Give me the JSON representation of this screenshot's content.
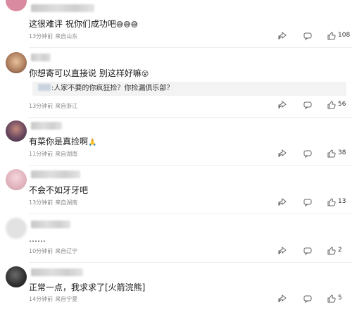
{
  "comments": [
    {
      "text": "这很难评 祝你们成功吧",
      "emoji": "😅😅😅",
      "time": "13分钟前",
      "location": "来自山东",
      "likes": "108",
      "icons": [
        "share-icon",
        "reply-icon",
        "like-icon"
      ]
    },
    {
      "text": "你想寄可以直接说 别这样好嘛",
      "emoji": "😵",
      "quote": ":人家不要的你疯狂捡？你捡漏俱乐部？",
      "time": "13分钟前",
      "location": "来自浙江",
      "likes": "56"
    },
    {
      "text": "有菜你是真捡啊",
      "emoji": "🙏",
      "time": "11分钟前",
      "location": "来自湖南",
      "likes": "38"
    },
    {
      "text": "不会不如牙牙吧",
      "time": "13分钟前",
      "location": "来自湖南",
      "likes": "13"
    },
    {
      "text": "……",
      "time": "10分钟前",
      "location": "来自辽宁",
      "likes": "2"
    },
    {
      "text": "正常一点，我求求了[火箭浣熊]",
      "time": "14分钟前",
      "location": "来自宁夏",
      "likes": "5"
    }
  ],
  "colors": {
    "meta": "#8a8a8a",
    "divider": "#eeeeee",
    "quote_bg": "#f3f3f3"
  }
}
